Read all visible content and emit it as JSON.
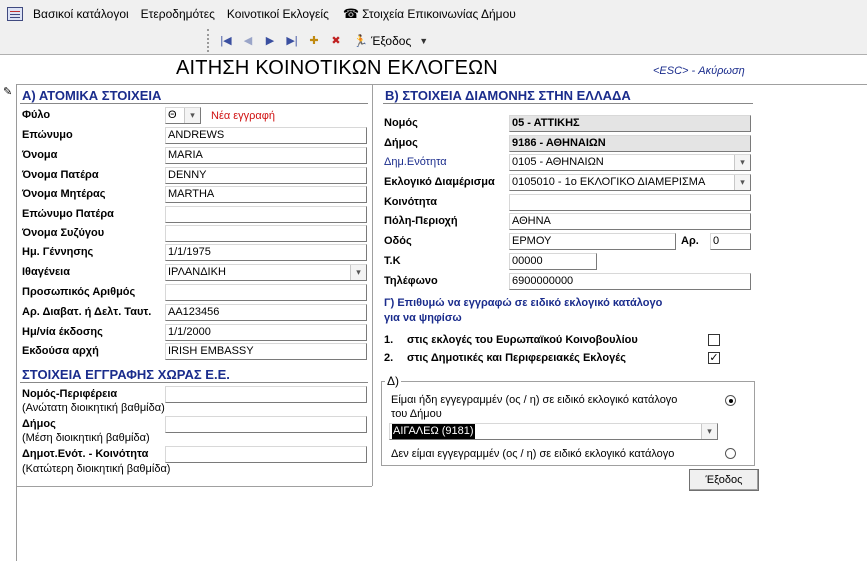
{
  "menu": {
    "items": [
      "Βασικοί κατάλογοι",
      "Ετεροδημότες",
      "Κοινοτικοί Εκλογείς",
      "Στοιχεία Επικοινωνίας Δήμου"
    ]
  },
  "toolbar": {
    "exit_label": "Έξοδος"
  },
  "form": {
    "title": "ΑΙΤΗΣΗ ΚΟΙΝΟΤΙΚΩΝ ΕΚΛΟΓΕΩΝ",
    "esc_hint": "<ESC> - Ακύρωση"
  },
  "sectionA": {
    "title": "Α) ΑΤΟΜΙΚΑ ΣΤΟΙΧΕΙΑ",
    "sex_label": "Φύλο",
    "sex_value": "Θ",
    "new_record": "Νέα εγγραφή",
    "surname_label": "Επώνυμο",
    "surname_value": "ANDREWS",
    "name_label": "Όνομα",
    "name_value": "MARIA",
    "father_label": "Όνομα Πατέρα",
    "father_value": "DENNY",
    "mother_label": "Όνομα Μητέρας",
    "mother_value": "MARTHA",
    "father_surname_label": "Επώνυμο Πατέρα",
    "father_surname_value": "",
    "spouse_label": "Όνομα Συζύγου",
    "spouse_value": "",
    "birth_label": "Ημ. Γέννησης",
    "birth_value": "1/1/1975",
    "nationality_label": "Ιθαγένεια",
    "nationality_value": "ΙΡΛΑΝΔΙΚΗ",
    "personal_no_label": "Προσωπικός Αριθμός",
    "personal_no_value": "",
    "passport_label": "Αρ. Διαβατ. ή Δελτ. Ταυτ.",
    "passport_value": "AA123456",
    "issue_date_label": "Ημ/νία έκδοσης",
    "issue_date_value": "1/1/2000",
    "authority_label": "Εκδούσα αρχή",
    "authority_value": "IRISH EMBASSY"
  },
  "sectionEU": {
    "title": "ΣΤΟΙΧΕΙΑ ΕΓΓΡΑΦΗΣ ΧΩΡΑΣ Ε.Ε.",
    "region_label": "Νομός-Περιφέρεια",
    "region_sub": "(Ανώτατη διοικητική βαθμίδα)",
    "region_value": "",
    "municipality_label": "Δήμος",
    "municipality_sub": "(Μέση διοικητική βαθμίδα)",
    "municipality_value": "",
    "community_label": "Δημοτ.Ενότ. - Κοινότητα",
    "community_sub": "(Κατώτερη διοικητική βαθμίδα)",
    "community_value": ""
  },
  "sectionB": {
    "title": "Β) ΣΤΟΙΧΕΙΑ ΔΙΑΜΟΝΗΣ ΣΤΗΝ ΕΛΛΑΔΑ",
    "prefecture_label": "Νομός",
    "prefecture_value": "05 - ΑΤΤΙΚΗΣ",
    "municipality_label": "Δήμος",
    "municipality_value": "9186 - ΑΘΗΝΑΙΩΝ",
    "unit_label": "Δημ.Ενότητα",
    "unit_value": "0105 - ΑΘΗΝΑΙΩΝ",
    "district_label": "Εκλογικό Διαμέρισμα",
    "district_value": "0105010 - 1ο ΕΚΛΟΓΙΚΟ ΔΙΑΜΕΡΙΣΜΑ",
    "community_label": "Κοινότητα",
    "community_value": "",
    "city_label": "Πόλη-Περιοχή",
    "city_value": "ΑΘΗΝΑ",
    "street_label": "Οδός",
    "street_value": "ΕΡΜΟΥ",
    "number_label": "Αρ.",
    "number_value": "0",
    "zip_label": "Τ.Κ",
    "zip_value": "00000",
    "phone_label": "Τηλέφωνο",
    "phone_value": "6900000000"
  },
  "sectionC": {
    "question_line1": "Γ) Επιθυμώ να εγγραφώ σε ειδικό εκλογικό κατάλογο",
    "question_line2": "για να ψηφίσω",
    "opt1_num": "1.",
    "opt1_label": "στις εκλογές του Ευρωπαϊκού Κοινοβουλίου",
    "opt1_checked": false,
    "opt2_num": "2.",
    "opt2_label": "στις Δημοτικές και Περιφερειακές Εκλογές",
    "opt2_checked": true
  },
  "sectionD": {
    "title": "Δ)",
    "registered_line1": "Είμαι ήδη εγγεγραμμέν (ος / η) σε ειδικό εκλογικό κατάλογο",
    "registered_line2": "του Δήμου",
    "municipality_value": "ΑΙΓΑΛΕΩ (9181)",
    "not_registered": "Δεν είμαι εγγεγραμμέν (ος / η) σε ειδικό εκλογικό κατάλογο",
    "selected": "registered"
  },
  "buttons": {
    "exit": "Έξοδος"
  }
}
